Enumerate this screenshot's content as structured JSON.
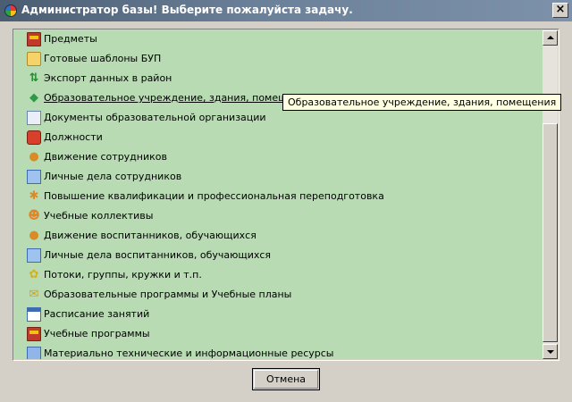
{
  "window": {
    "title": "Администратор базы! Выберите пожалуйста задачу.",
    "close_glyph": "×"
  },
  "list": {
    "items": [
      {
        "label": "Предметы",
        "icon": "blackboard-icon"
      },
      {
        "label": "Готовые шаблоны БУП",
        "icon": "folder-icon"
      },
      {
        "label": "Экспорт данных в район",
        "icon": "sync-arrows-icon"
      },
      {
        "label": "Образовательное учреждение, здания, помещения",
        "icon": "school-building-icon",
        "hovered": true
      },
      {
        "label": "Документы образовательной организации",
        "icon": "document-icon"
      },
      {
        "label": "Должности",
        "icon": "briefcase-icon"
      },
      {
        "label": "Движение сотрудников",
        "icon": "person-icon"
      },
      {
        "label": "Личные дела сотрудников",
        "icon": "id-card-icon"
      },
      {
        "label": "Повышение квалификации и профессиональная переподготовка",
        "icon": "person-gear-icon"
      },
      {
        "label": "Учебные коллективы",
        "icon": "group-icon"
      },
      {
        "label": "Движение воспитанников, обучающихся",
        "icon": "student-icon"
      },
      {
        "label": "Личные дела воспитанников, обучающихся",
        "icon": "student-card-icon"
      },
      {
        "label": "Потоки, группы, кружки и т.п.",
        "icon": "flower-icon"
      },
      {
        "label": "Образовательные программы и Учебные планы",
        "icon": "envelope-icon"
      },
      {
        "label": "Расписание занятий",
        "icon": "calendar-icon"
      },
      {
        "label": "Учебные программы",
        "icon": "blackboard-icon"
      },
      {
        "label": "Материально технические и информационные ресурсы",
        "icon": "monitor-icon"
      }
    ]
  },
  "tooltip": {
    "text": "Образовательное учреждение, здания, помещения"
  },
  "buttons": {
    "cancel_label": "Отмена"
  },
  "colors": {
    "list_background": "#b8dbb4",
    "tooltip_background": "#ffffe1",
    "titlebar_start": "#4a5d72",
    "titlebar_end": "#7d92aa"
  }
}
